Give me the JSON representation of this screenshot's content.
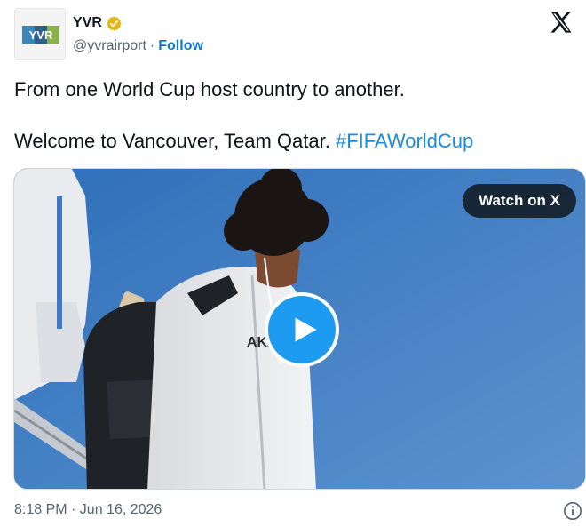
{
  "author": {
    "display_name": "YVR",
    "handle": "@yvrairport",
    "separator": "·",
    "follow_label": "Follow",
    "avatar_text": "YVR",
    "verified": true
  },
  "tweet": {
    "line1": "From one World Cup host country to another.",
    "line2_text": "Welcome to Vancouver, Team Qatar. ",
    "hashtag": "#FIFAWorldCup",
    "timestamp": "8:18 PM · Jun 16, 2026"
  },
  "media": {
    "watch_label": "Watch on X",
    "jacket_text": "AKZ"
  },
  "icons": {
    "platform": "x-logo-icon",
    "verified": "verified-badge-icon",
    "play": "play-icon",
    "info": "info-icon"
  },
  "colors": {
    "link": "#0f7ad1",
    "hashtag": "#1d8bd6",
    "play_button": "#1d9bf0",
    "verified_badge": "#e2b719",
    "sky": "#3a7bc7"
  }
}
